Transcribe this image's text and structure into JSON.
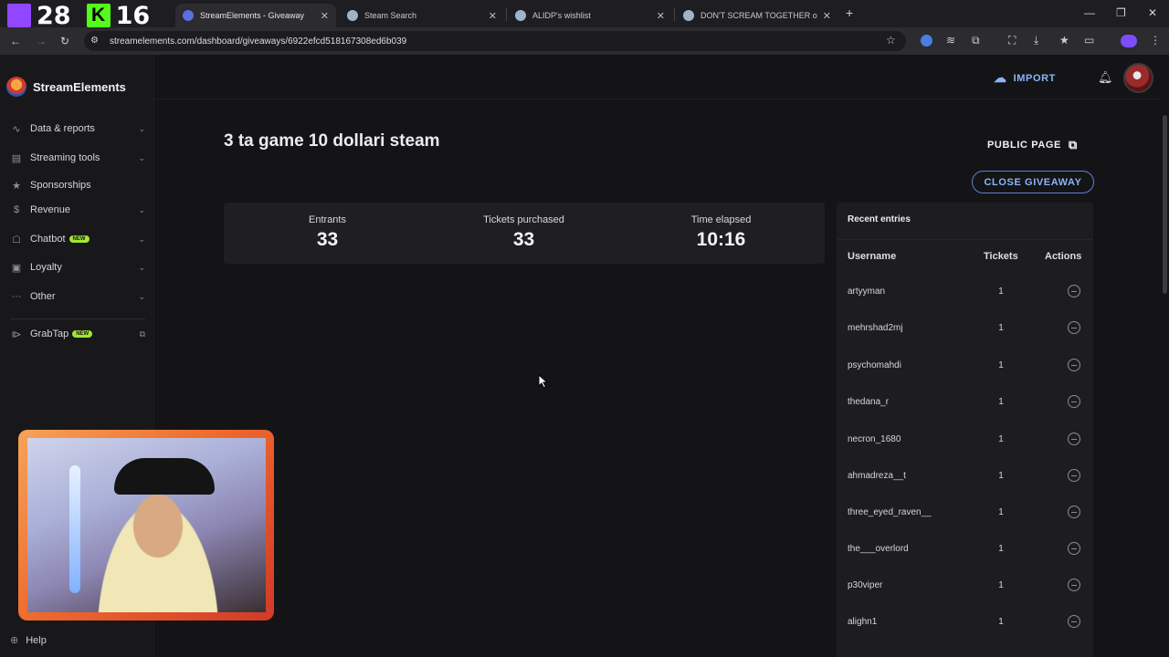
{
  "overlay": {
    "count_a": "28",
    "count_b": "16"
  },
  "browser": {
    "tabs": [
      {
        "title": "",
        "active": false
      },
      {
        "title": "StreamElements - Giveaway",
        "active": true
      },
      {
        "title": "Steam Search",
        "active": false
      },
      {
        "title": "ALIDP's wishlist",
        "active": false
      },
      {
        "title": "DON'T SCREAM TOGETHER on Steam",
        "active": false
      }
    ],
    "url": "streamelements.com/dashboard/giveaways/6922efcd518167308ed6b039"
  },
  "sidebar": {
    "brand": "StreamElements",
    "items": [
      {
        "label": "Data & reports",
        "icon": "chart-line-icon",
        "chevron": true
      },
      {
        "label": "Streaming tools",
        "icon": "layout-icon",
        "chevron": true
      },
      {
        "label": "Sponsorships",
        "icon": "star-icon",
        "chevron": false
      },
      {
        "label": "Revenue",
        "icon": "dollar-icon",
        "chevron": true
      },
      {
        "label": "Chatbot",
        "icon": "robot-icon",
        "chevron": true,
        "badge": "NEW"
      },
      {
        "label": "Loyalty",
        "icon": "gift-icon",
        "chevron": true
      },
      {
        "label": "Other",
        "icon": "dots-icon",
        "chevron": true
      },
      {
        "label": "GrabTap",
        "icon": "grabtap-icon",
        "badge": "NEW",
        "external": true
      }
    ],
    "help": "Help"
  },
  "header": {
    "import_label": "IMPORT"
  },
  "giveaway": {
    "title": "3 ta game 10 dollari steam",
    "public_page_label": "PUBLIC PAGE",
    "close_label": "CLOSE GIVEAWAY",
    "stats": [
      {
        "label": "Entrants",
        "value": "33"
      },
      {
        "label": "Tickets purchased",
        "value": "33"
      },
      {
        "label": "Time elapsed",
        "value": "10:16"
      }
    ]
  },
  "entries": {
    "title": "Recent entries",
    "columns": [
      "Username",
      "Tickets",
      "Actions"
    ],
    "rows": [
      {
        "username": "artyyman",
        "tickets": "1"
      },
      {
        "username": "mehrshad2mj",
        "tickets": "1"
      },
      {
        "username": "psychomahdi",
        "tickets": "1"
      },
      {
        "username": "thedana_r",
        "tickets": "1"
      },
      {
        "username": "necron_1680",
        "tickets": "1"
      },
      {
        "username": "ahmadreza__t",
        "tickets": "1"
      },
      {
        "username": "three_eyed_raven__",
        "tickets": "1"
      },
      {
        "username": "the___overlord",
        "tickets": "1"
      },
      {
        "username": "p30viper",
        "tickets": "1"
      },
      {
        "username": "alighn1",
        "tickets": "1"
      }
    ]
  },
  "colors": {
    "accent": "#8ab4f8",
    "new_badge": "#a3e635",
    "background": "#141416"
  }
}
